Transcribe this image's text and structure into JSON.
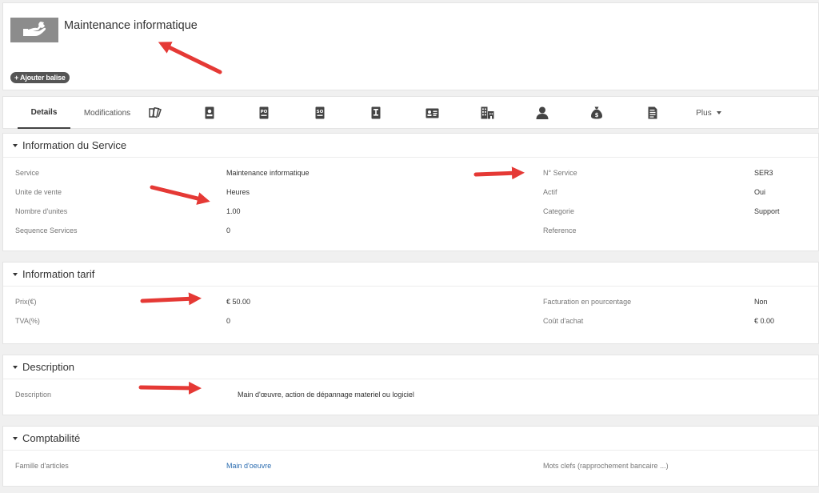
{
  "header": {
    "title": "Maintenance informatique",
    "icon": "service-hand-wrench-icon",
    "add_tag_label": "+ Ajouter balise"
  },
  "tabs": {
    "details": "Details",
    "modifications": "Modifications",
    "icons": [
      "price-books-icon",
      "contacts-icon",
      "purchase-order-icon",
      "sales-order-icon",
      "invoice-icon",
      "vcard-icon",
      "organization-icon",
      "user-icon",
      "money-bag-icon",
      "document-icon"
    ],
    "more": "Plus"
  },
  "sections": {
    "service": {
      "title": "Information du Service",
      "left": [
        {
          "label": "Service",
          "value": "Maintenance informatique"
        },
        {
          "label": "Unite de vente",
          "value": "Heures"
        },
        {
          "label": "Nombre d'unites",
          "value": "1.00"
        },
        {
          "label": "Sequence Services",
          "value": "0"
        }
      ],
      "right": [
        {
          "label": "N° Service",
          "value": "SER3"
        },
        {
          "label": "Actif",
          "value": "Oui"
        },
        {
          "label": "Categorie",
          "value": "Support"
        },
        {
          "label": "Reference",
          "value": ""
        }
      ]
    },
    "tarif": {
      "title": "Information tarif",
      "left": [
        {
          "label": "Prix(€)",
          "value": "€ 50.00"
        },
        {
          "label": "TVA(%)",
          "value": "0"
        }
      ],
      "right": [
        {
          "label": "Facturation en pourcentage",
          "value": "Non"
        },
        {
          "label": "Coût d'achat",
          "value": "€ 0.00"
        }
      ]
    },
    "description": {
      "title": "Description",
      "label": "Description",
      "value": "Main d'œuvre, action de dépannage materiel ou logiciel"
    },
    "compta": {
      "title": "Comptabilité",
      "family_label": "Famille d'articles",
      "family_value": "Main d'oeuvre",
      "keywords_label": "Mots clefs (rapprochement bancaire ...)"
    }
  },
  "colors": {
    "annotation_arrow": "#e53935",
    "link": "#2b6cb0"
  }
}
